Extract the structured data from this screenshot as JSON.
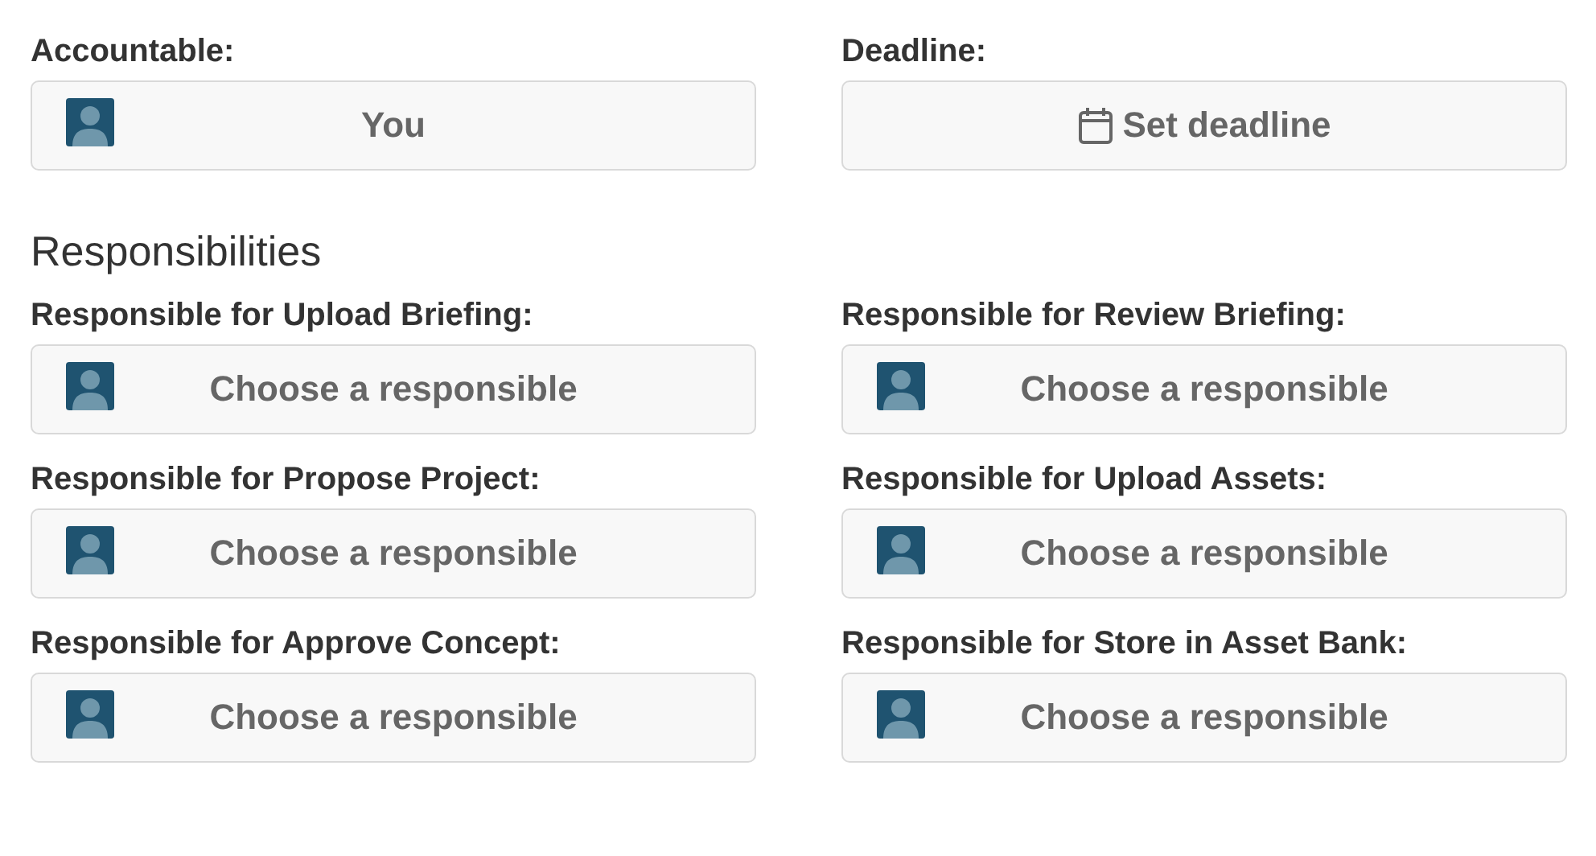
{
  "top_fields": [
    {
      "label": "Accountable:",
      "kind": "person",
      "value": "You"
    },
    {
      "label": "Deadline:",
      "kind": "date",
      "value": "Set deadline"
    }
  ],
  "section_title": "Responsibilities",
  "responsibilities": [
    {
      "label": "Responsible for Upload Briefing:",
      "kind": "person",
      "value": "Choose a responsible"
    },
    {
      "label": "Responsible for Review Briefing:",
      "kind": "person",
      "value": "Choose a responsible"
    },
    {
      "label": "Responsible for Propose Project:",
      "kind": "person",
      "value": "Choose a responsible"
    },
    {
      "label": "Responsible for Upload Assets:",
      "kind": "person",
      "value": "Choose a responsible"
    },
    {
      "label": "Responsible for Approve Concept:",
      "kind": "person",
      "value": "Choose a responsible"
    },
    {
      "label": "Responsible for Store in Asset Bank:",
      "kind": "person",
      "value": "Choose a responsible"
    }
  ]
}
